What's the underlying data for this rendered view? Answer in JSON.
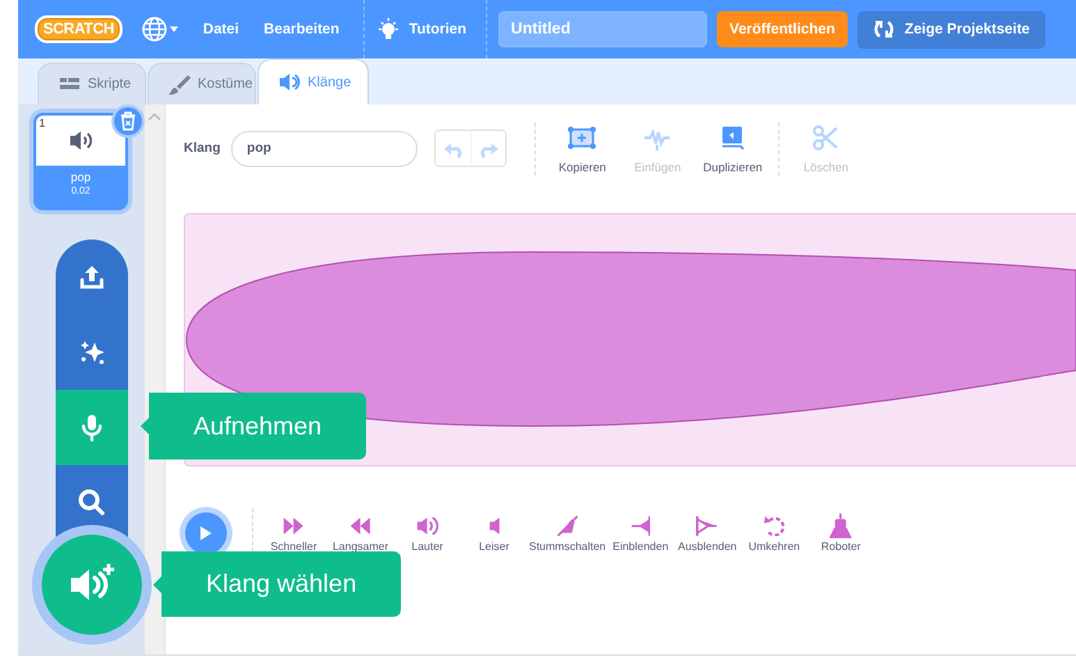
{
  "menu_bar": {
    "logo": "SCRATCH",
    "items": [
      {
        "kind": "language"
      },
      {
        "kind": "menu",
        "label": "Datei"
      },
      {
        "kind": "menu",
        "label": "Bearbeiten"
      },
      {
        "kind": "tutorials",
        "label": "Tutorien"
      }
    ],
    "project_title": "Untitled",
    "publish_button": "Veröffentlichen",
    "project_page_button": "Zeige Projektseite"
  },
  "tabs": [
    {
      "label": "Skripte",
      "kind": "code",
      "selected": false
    },
    {
      "label": "Kostüme",
      "kind": "costume",
      "selected": false
    },
    {
      "label": "Klänge",
      "kind": "sound",
      "selected": true
    }
  ],
  "sounds": [
    {
      "number": "1",
      "name": "pop",
      "duration": "0.02",
      "selected": true
    }
  ],
  "editor": {
    "name_label": "Klang",
    "name_value": "pop",
    "undo_disabled": true,
    "redo_disabled": true,
    "tools": [
      {
        "kind": "copy",
        "label": "Kopieren",
        "disabled": false
      },
      {
        "kind": "paste",
        "label": "Einfügen",
        "disabled": true
      },
      {
        "kind": "duplicate",
        "label": "Duplizieren",
        "disabled": false
      },
      {
        "kind": "delete",
        "label": "Löschen",
        "disabled": true
      }
    ],
    "effects": [
      {
        "kind": "faster",
        "label": "Schneller"
      },
      {
        "kind": "slower",
        "label": "Langsamer"
      },
      {
        "kind": "louder",
        "label": "Lauter"
      },
      {
        "kind": "softer",
        "label": "Leiser"
      },
      {
        "kind": "mute",
        "label": "Stummschalten"
      },
      {
        "kind": "fadein",
        "label": "Einblenden"
      },
      {
        "kind": "fadeout",
        "label": "Ausblenden"
      },
      {
        "kind": "reverse",
        "label": "Umkehren"
      },
      {
        "kind": "robot",
        "label": "Roboter"
      }
    ]
  },
  "add_menu": {
    "items": [
      {
        "kind": "upload",
        "hovered": false
      },
      {
        "kind": "surprise",
        "hovered": false
      },
      {
        "kind": "record",
        "hovered": true,
        "tooltip": "Aufnehmen"
      },
      {
        "kind": "search",
        "hovered": false
      }
    ],
    "main_tooltip": "Klang wählen"
  }
}
